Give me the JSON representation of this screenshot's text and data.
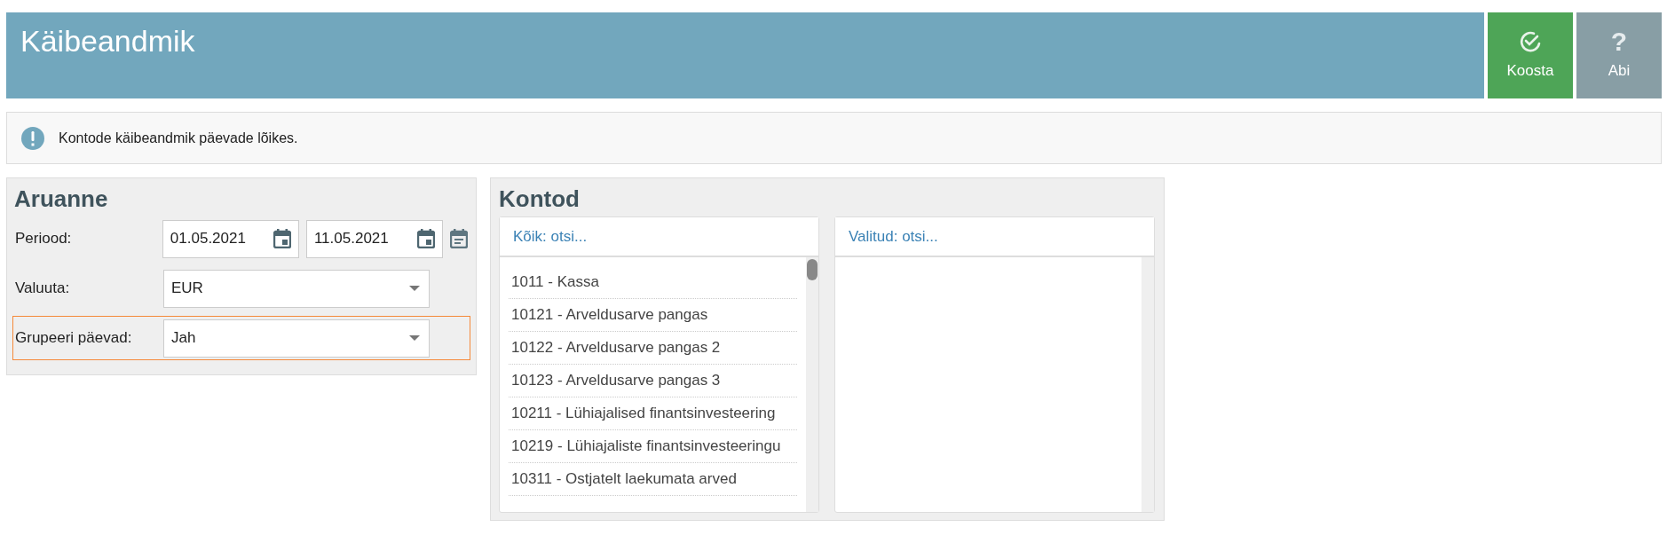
{
  "header": {
    "title": "Käibeandmik",
    "buttons": [
      {
        "kind": "check",
        "label": "Koosta"
      },
      {
        "kind": "help",
        "icon": "?",
        "label": "Abi"
      }
    ]
  },
  "info": {
    "text": "Kontode käibeandmik päevade lõikes."
  },
  "report": {
    "title": "Aruanne",
    "rows": [
      {
        "kind": "dates",
        "label": "Periood:",
        "highlighted": false,
        "from": "01.05.2021",
        "to": "11.05.2021"
      },
      {
        "kind": "select",
        "label": "Valuuta:",
        "highlighted": false,
        "value": "EUR"
      },
      {
        "kind": "select",
        "label": "Grupeeri päevad:",
        "highlighted": true,
        "value": "Jah"
      }
    ]
  },
  "accounts": {
    "title": "Kontod",
    "all": {
      "placeholder": "Kõik: otsi...",
      "items": [
        "1011 - Kassa",
        "10121 - Arveldusarve pangas",
        "10122 - Arveldusarve pangas 2",
        "10123 - Arveldusarve pangas 3",
        "10211 - Lühiajalised finantsinvesteering",
        "10219 - Lühiajaliste finantsinvesteeringu",
        "10311 - Ostjatelt laekumata arved"
      ]
    },
    "selected": {
      "placeholder": "Valitud: otsi..."
    }
  }
}
